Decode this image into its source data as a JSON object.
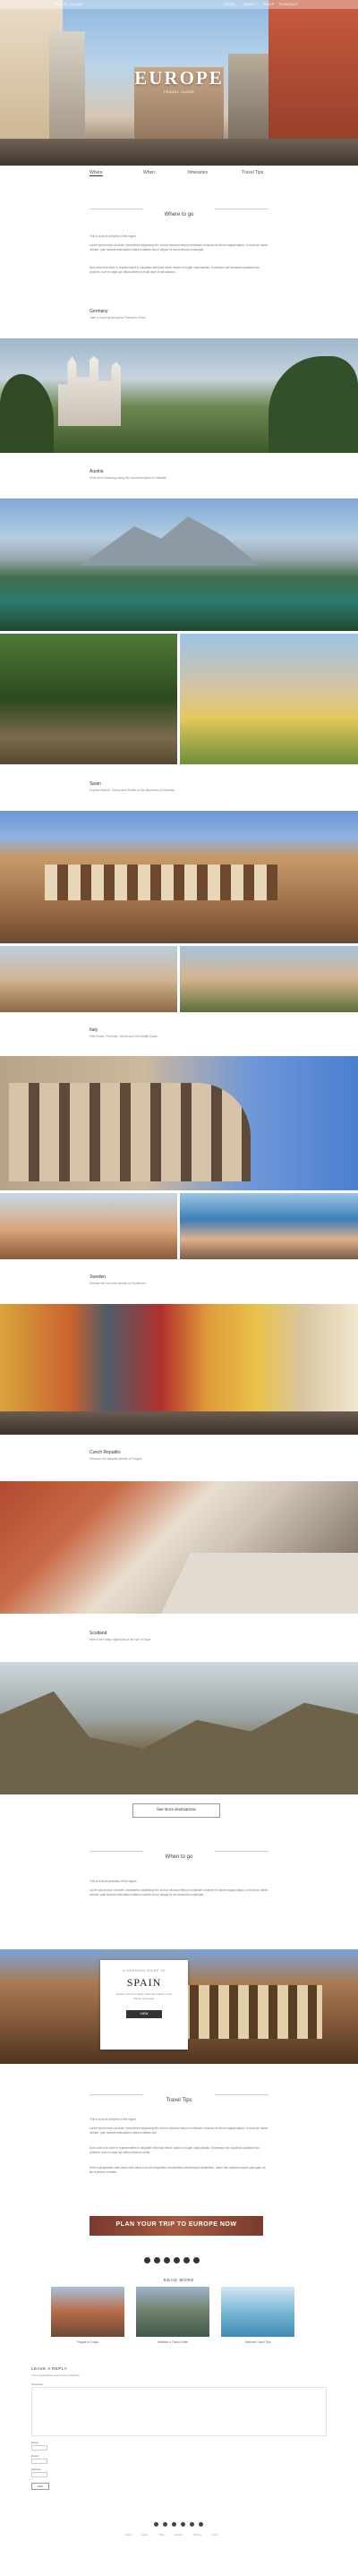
{
  "topbar": {
    "left": "TRAVEL GUIDE",
    "right": [
      "HOME",
      "ABOUT",
      "SHOP",
      "CONTACT"
    ]
  },
  "hero": {
    "title": "EUROPE",
    "subtitle": "TRAVEL GUIDE"
  },
  "nav": [
    "Where",
    "When",
    "Itineraries",
    "Travel Tips"
  ],
  "where_to_go": {
    "heading": "Where to go",
    "paragraphs": [
      "This is a short overview of the region.",
      "Lorem ipsum dolor sit amet, consectetur adipiscing elit, sed do eiusmod tempor incididunt ut labore et dolore magna aliqua. Ut enim ad minim veniam, quis nostrud exercitation ullamco laboris nisi ut aliquip ex ea commodo consequat.",
      "Duis aute irure dolor in reprehenderit in voluptate velit esse cillum dolore eu fugiat nulla pariatur. Excepteur sint occaecat cupidatat non proident, sunt in culpa qui officia deserunt mollit anim id est laborum."
    ]
  },
  "countries": [
    {
      "name": "Germany",
      "sub": "Take a road trip along the Romantic Road"
    },
    {
      "name": "Austria",
      "sub": "Drive from Salzburg along the mountain lakes to Hallstatt"
    },
    {
      "name": "Spain",
      "sub": "Explore Madrid, Toledo and Seville to the Alhambra of Granada"
    },
    {
      "name": "Italy",
      "sub": "Visit Rome, Florence, Venice and the Amalfi Coast"
    },
    {
      "name": "Sweden",
      "sub": "Wander the old town streets of Stockholm"
    },
    {
      "name": "Czech Republic",
      "sub": "Discover the fairytale streets of Prague"
    },
    {
      "name": "Scotland",
      "sub": "Hike in the misty highlands of the Isle of Skye"
    }
  ],
  "more_button": "See more destinations",
  "when_to_go": {
    "heading": "When to go",
    "paragraphs": [
      "This is a short summary of the region.",
      "Lorem ipsum dolor sit amet, consectetur adipiscing elit, sed do eiusmod tempor incididunt ut labore et dolore magna aliqua. Ut enim ad minim veniam, quis nostrud exercitation ullamco laboris nisi ut aliquip ex ea commodo consequat."
    ]
  },
  "card": {
    "kicker": "A WEEKEND GUIDE TO",
    "title": "SPAIN",
    "body": "Explore the best sights, food and culture of the Iberian peninsula.",
    "button": "VIEW"
  },
  "travel_tips": {
    "heading": "Travel Tips",
    "paragraphs": [
      "This is a short overview of the region.",
      "Lorem ipsum dolor sit amet, consectetur adipiscing elit, sed do eiusmod tempor incididunt ut labore et dolore magna aliqua. Ut enim ad minim veniam, quis nostrud exercitation ullamco laboris nisi.",
      "Duis aute irure dolor in reprehenderit in voluptate velit esse cillum dolore eu fugiat nulla pariatur. Excepteur sint occaecat cupidatat non proident, sunt in culpa qui officia deserunt mollit.",
      "Sed ut perspiciatis unde omnis iste natus error sit voluptatem accusantium doloremque laudantium, totam rem aperiam eaque ipsa quae ab illo inventore veritatis."
    ],
    "banner": "PLAN YOUR TRIP TO EUROPE NOW"
  },
  "read_more": {
    "heading": "READ MORE",
    "items": [
      {
        "caption": "Prague in 3 days"
      },
      {
        "caption": "Hallstatt: A Travel Guide"
      },
      {
        "caption": "Santorini Travel Tips"
      }
    ]
  },
  "comment": {
    "heading": "LEAVE A REPLY",
    "note": "Your email address will not be published.",
    "labels": [
      "Comment",
      "Name",
      "Email",
      "Website"
    ],
    "submit": "Post"
  },
  "footer": {
    "links": [
      "Home",
      "About",
      "Shop",
      "Contact",
      "Privacy",
      "Terms"
    ]
  },
  "colors": {
    "accent": "#c6534a",
    "banner": "#7a3a2e"
  }
}
